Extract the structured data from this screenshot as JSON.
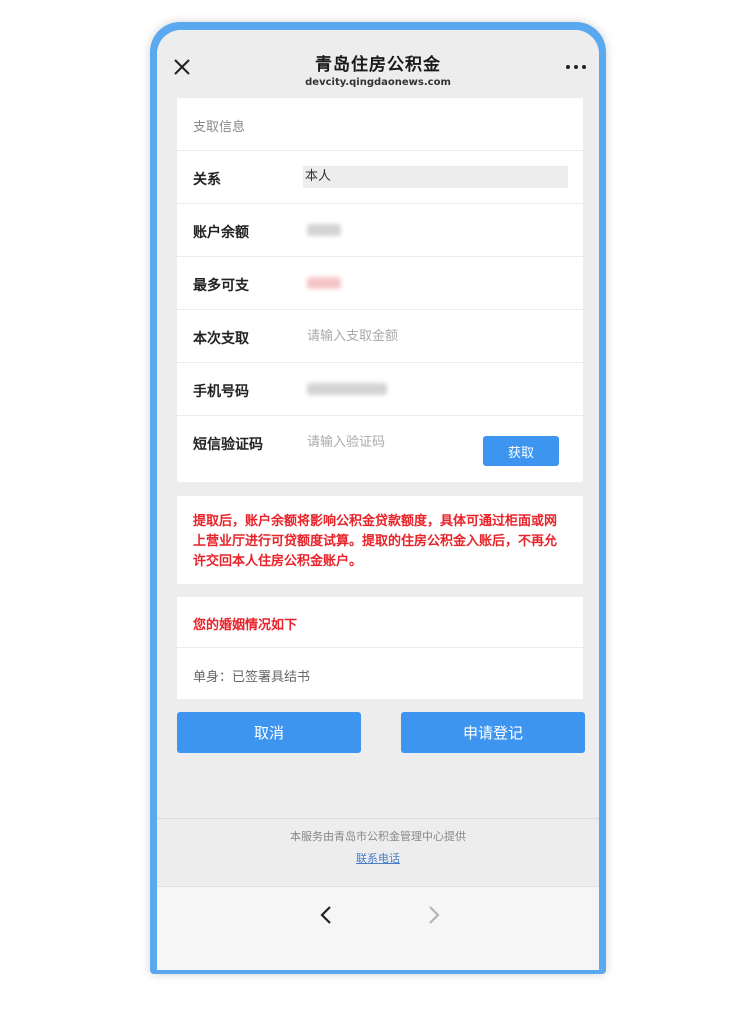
{
  "header": {
    "title": "青岛住房公积金",
    "url": "devcity.qingdaonews.com"
  },
  "form": {
    "section_title": "支取信息",
    "relation_label": "关系",
    "relation_value": "本人",
    "balance_label": "账户余额",
    "max_label": "最多可支",
    "amount_label": "本次支取",
    "amount_placeholder": "请输入支取金额",
    "phone_label": "手机号码",
    "sms_label": "短信验证码",
    "sms_placeholder": "请输入验证码",
    "get_code_label": "获取"
  },
  "notice": {
    "text": "提取后，账户余额将影响公积金贷款额度，具体可通过柜面或网上营业厅进行可贷额度试算。提取的住房公积金入账后，不再允许交回本人住房公积金账户。"
  },
  "marriage": {
    "title": "您的婚姻情况如下",
    "status": "单身：已签署具结书"
  },
  "actions": {
    "cancel_label": "取消",
    "submit_label": "申请登记"
  },
  "footer": {
    "provider_text": "本服务由青岛市公积金管理中心提供",
    "contact_link": "联系电话"
  },
  "colors": {
    "primary": "#3d95f0",
    "warning": "#e8232a",
    "background": "#ededed",
    "frame": "#5aa9f0"
  },
  "icons": {
    "close": "close-icon",
    "more": "more-dots-icon",
    "back": "chevron-left-icon",
    "forward": "chevron-right-icon"
  }
}
